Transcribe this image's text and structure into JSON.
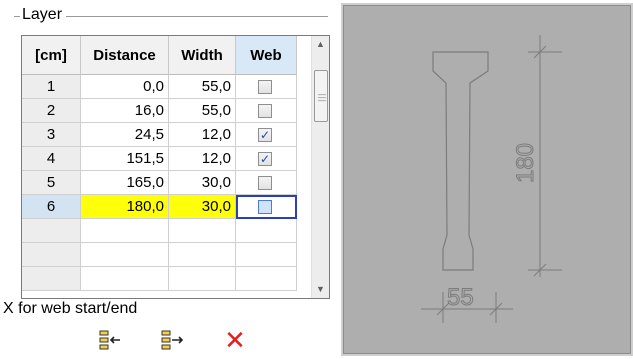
{
  "layer_group": {
    "title": "Layer",
    "columns": [
      "[cm]",
      "Distance",
      "Width",
      "Web"
    ],
    "rows": [
      {
        "num": "1",
        "distance": "0,0",
        "width": "55,0",
        "web": false
      },
      {
        "num": "2",
        "distance": "16,0",
        "width": "55,0",
        "web": false
      },
      {
        "num": "3",
        "distance": "24,5",
        "width": "12,0",
        "web": true
      },
      {
        "num": "4",
        "distance": "151,5",
        "width": "12,0",
        "web": true
      },
      {
        "num": "5",
        "distance": "165,0",
        "width": "30,0",
        "web": false
      },
      {
        "num": "6",
        "distance": "180,0",
        "width": "30,0",
        "web": false,
        "selected": true
      }
    ],
    "caption": "X for web start/end"
  },
  "toolbar": {
    "insert_icon": "insert-row-icon",
    "append_icon": "append-row-icon",
    "delete_icon": "delete-icon"
  },
  "preview": {
    "height_label": "180",
    "width_label": "55"
  },
  "colors": {
    "selected_row": "#ffff0a",
    "selected_border": "#2a3fb8",
    "delete": "#e81e1e",
    "preview_bg": "#aeaeae"
  }
}
